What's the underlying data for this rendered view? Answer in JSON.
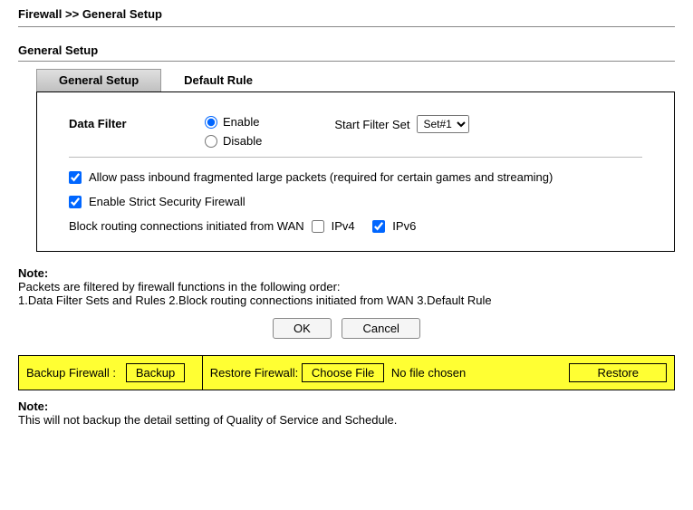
{
  "breadcrumb": "Firewall >> General Setup",
  "section_title": "General Setup",
  "tabs": {
    "general": "General Setup",
    "default_rule": "Default Rule"
  },
  "panel": {
    "data_filter_label": "Data Filter",
    "enable_label": "Enable",
    "disable_label": "Disable",
    "start_filter_set_label": "Start Filter Set",
    "filter_set_options": [
      "Set#1"
    ],
    "filter_set_selected": "Set#1",
    "allow_pass_label": "Allow pass inbound fragmented large packets (required for certain games and streaming)",
    "strict_label": "Enable Strict Security Firewall",
    "block_label": "Block routing connections initiated from WAN",
    "ipv4_label": "IPv4",
    "ipv6_label": "IPv6"
  },
  "note1": {
    "title": "Note:",
    "line1": "Packets are filtered by firewall functions in the following order:",
    "line2": "1.Data Filter Sets and Rules  2.Block routing connections initiated from WAN  3.Default Rule"
  },
  "buttons": {
    "ok": "OK",
    "cancel": "Cancel"
  },
  "backup_row": {
    "backup_label": "Backup Firewall :",
    "backup_btn": "Backup",
    "restore_label": "Restore Firewall:",
    "choose_file_btn": "Choose File",
    "no_file": "No file chosen",
    "restore_btn": "Restore"
  },
  "note2": {
    "title": "Note:",
    "text": "This will not backup the detail setting of Quality of Service and Schedule."
  }
}
